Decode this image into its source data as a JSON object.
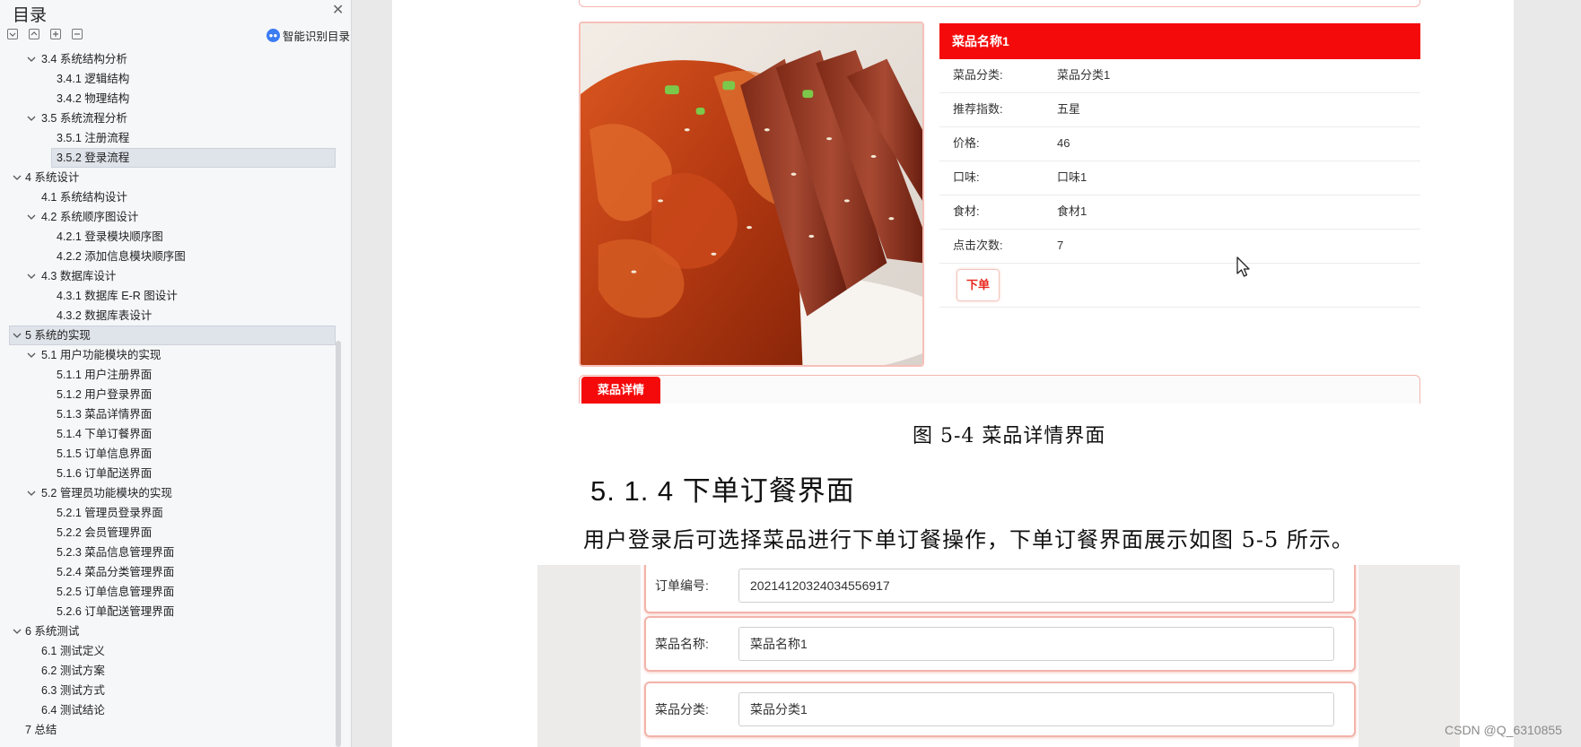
{
  "sidebar": {
    "title": "目录",
    "smart_toc_label": "智能识别目录",
    "toc": [
      {
        "label": "3.4  系统结构分析",
        "level": 1,
        "expanded": true
      },
      {
        "label": "3.4.1 逻辑结构",
        "level": 2
      },
      {
        "label": "3.4.2 物理结构",
        "level": 2
      },
      {
        "label": "3.5  系统流程分析",
        "level": 1,
        "expanded": true
      },
      {
        "label": "3.5.1 注册流程",
        "level": 2
      },
      {
        "label": "3.5.2 登录流程",
        "level": 2,
        "selected": true
      },
      {
        "label": "4  系统设计",
        "level": 0,
        "expanded": true
      },
      {
        "label": "4.1 系统结构设计",
        "level": 1
      },
      {
        "label": "4.2 系统顺序图设计",
        "level": 1,
        "expanded": true
      },
      {
        "label": "4.2.1 登录模块顺序图",
        "level": 2
      },
      {
        "label": "4.2.2 添加信息模块顺序图",
        "level": 2
      },
      {
        "label": "4.3  数据库设计",
        "level": 1,
        "expanded": true
      },
      {
        "label": "4.3.1  数据库 E-R 图设计",
        "level": 2
      },
      {
        "label": "4.3.2  数据库表设计",
        "level": 2
      },
      {
        "label": "5  系统的实现",
        "level": 0,
        "expanded": true,
        "selected": true
      },
      {
        "label": "5.1  用户功能模块的实现",
        "level": 1,
        "expanded": true
      },
      {
        "label": "5.1.1 用户注册界面",
        "level": 2
      },
      {
        "label": "5.1.2 用户登录界面",
        "level": 2
      },
      {
        "label": "5.1.3 菜品详情界面",
        "level": 2
      },
      {
        "label": "5.1.4 下单订餐界面",
        "level": 2
      },
      {
        "label": "5.1.5 订单信息界面",
        "level": 2
      },
      {
        "label": "5.1.6 订单配送界面",
        "level": 2
      },
      {
        "label": "5.2  管理员功能模块的实现",
        "level": 1,
        "expanded": true
      },
      {
        "label": "5.2.1 管理员登录界面",
        "level": 2
      },
      {
        "label": "5.2.2 会员管理界面",
        "level": 2
      },
      {
        "label": "5.2.3 菜品信息管理界面",
        "level": 2
      },
      {
        "label": "5.2.4 菜品分类管理界面",
        "level": 2
      },
      {
        "label": "5.2.5 订单信息管理界面",
        "level": 2
      },
      {
        "label": "5.2.6 订单配送管理界面",
        "level": 2
      },
      {
        "label": "6  系统测试",
        "level": 0,
        "expanded": true
      },
      {
        "label": "6.1 测试定义",
        "level": 1
      },
      {
        "label": "6.2 测试方案",
        "level": 1
      },
      {
        "label": "6.3 测试方式",
        "level": 1
      },
      {
        "label": "6.4 测试结论",
        "level": 1
      },
      {
        "label": "7  总结",
        "level": 0
      }
    ]
  },
  "figure1": {
    "dish_name": "菜品名称1",
    "rows": [
      {
        "key": "菜品分类:",
        "value": "菜品分类1"
      },
      {
        "key": "推荐指数:",
        "value": "五星"
      },
      {
        "key": "价格:",
        "value": "46"
      },
      {
        "key": "口味:",
        "value": "口味1"
      },
      {
        "key": "食材:",
        "value": "食材1"
      },
      {
        "key": "点击次数:",
        "value": "7"
      }
    ],
    "order_button": "下单",
    "detail_tab": "菜品详情"
  },
  "doc": {
    "caption": "图  5-4    菜品详情界面",
    "heading": "5. 1. 4 下单订餐界面",
    "paragraph": "用户登录后可选择菜品进行下单订餐操作，下单订餐界面展示如图 5-5 所示。"
  },
  "figure2": {
    "rows": [
      {
        "label": "订单编号:",
        "value": "2021412032403455691​7"
      },
      {
        "label": "菜品名称:",
        "value": "菜品名称1"
      },
      {
        "label": "菜品分类:",
        "value": "菜品分类1"
      }
    ]
  },
  "watermark": "CSDN @Q_6310855",
  "colors": {
    "accent_red": "#f40a0a",
    "border_pink": "#f3b3aa"
  }
}
